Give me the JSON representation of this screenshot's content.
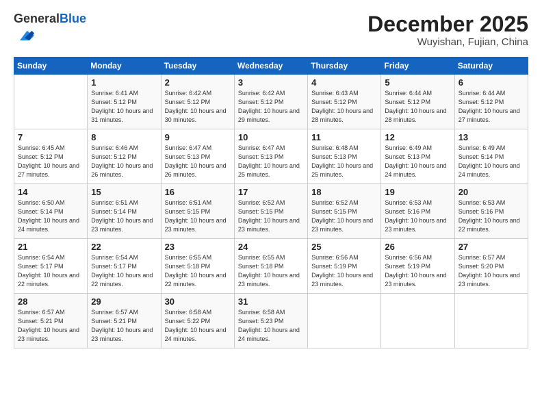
{
  "header": {
    "logo_general": "General",
    "logo_blue": "Blue",
    "month": "December 2025",
    "location": "Wuyishan, Fujian, China"
  },
  "weekdays": [
    "Sunday",
    "Monday",
    "Tuesday",
    "Wednesday",
    "Thursday",
    "Friday",
    "Saturday"
  ],
  "weeks": [
    [
      {
        "day": "",
        "sunrise": "",
        "sunset": "",
        "daylight": ""
      },
      {
        "day": "1",
        "sunrise": "Sunrise: 6:41 AM",
        "sunset": "Sunset: 5:12 PM",
        "daylight": "Daylight: 10 hours and 31 minutes."
      },
      {
        "day": "2",
        "sunrise": "Sunrise: 6:42 AM",
        "sunset": "Sunset: 5:12 PM",
        "daylight": "Daylight: 10 hours and 30 minutes."
      },
      {
        "day": "3",
        "sunrise": "Sunrise: 6:42 AM",
        "sunset": "Sunset: 5:12 PM",
        "daylight": "Daylight: 10 hours and 29 minutes."
      },
      {
        "day": "4",
        "sunrise": "Sunrise: 6:43 AM",
        "sunset": "Sunset: 5:12 PM",
        "daylight": "Daylight: 10 hours and 28 minutes."
      },
      {
        "day": "5",
        "sunrise": "Sunrise: 6:44 AM",
        "sunset": "Sunset: 5:12 PM",
        "daylight": "Daylight: 10 hours and 28 minutes."
      },
      {
        "day": "6",
        "sunrise": "Sunrise: 6:44 AM",
        "sunset": "Sunset: 5:12 PM",
        "daylight": "Daylight: 10 hours and 27 minutes."
      }
    ],
    [
      {
        "day": "7",
        "sunrise": "Sunrise: 6:45 AM",
        "sunset": "Sunset: 5:12 PM",
        "daylight": "Daylight: 10 hours and 27 minutes."
      },
      {
        "day": "8",
        "sunrise": "Sunrise: 6:46 AM",
        "sunset": "Sunset: 5:12 PM",
        "daylight": "Daylight: 10 hours and 26 minutes."
      },
      {
        "day": "9",
        "sunrise": "Sunrise: 6:47 AM",
        "sunset": "Sunset: 5:13 PM",
        "daylight": "Daylight: 10 hours and 26 minutes."
      },
      {
        "day": "10",
        "sunrise": "Sunrise: 6:47 AM",
        "sunset": "Sunset: 5:13 PM",
        "daylight": "Daylight: 10 hours and 25 minutes."
      },
      {
        "day": "11",
        "sunrise": "Sunrise: 6:48 AM",
        "sunset": "Sunset: 5:13 PM",
        "daylight": "Daylight: 10 hours and 25 minutes."
      },
      {
        "day": "12",
        "sunrise": "Sunrise: 6:49 AM",
        "sunset": "Sunset: 5:13 PM",
        "daylight": "Daylight: 10 hours and 24 minutes."
      },
      {
        "day": "13",
        "sunrise": "Sunrise: 6:49 AM",
        "sunset": "Sunset: 5:14 PM",
        "daylight": "Daylight: 10 hours and 24 minutes."
      }
    ],
    [
      {
        "day": "14",
        "sunrise": "Sunrise: 6:50 AM",
        "sunset": "Sunset: 5:14 PM",
        "daylight": "Daylight: 10 hours and 24 minutes."
      },
      {
        "day": "15",
        "sunrise": "Sunrise: 6:51 AM",
        "sunset": "Sunset: 5:14 PM",
        "daylight": "Daylight: 10 hours and 23 minutes."
      },
      {
        "day": "16",
        "sunrise": "Sunrise: 6:51 AM",
        "sunset": "Sunset: 5:15 PM",
        "daylight": "Daylight: 10 hours and 23 minutes."
      },
      {
        "day": "17",
        "sunrise": "Sunrise: 6:52 AM",
        "sunset": "Sunset: 5:15 PM",
        "daylight": "Daylight: 10 hours and 23 minutes."
      },
      {
        "day": "18",
        "sunrise": "Sunrise: 6:52 AM",
        "sunset": "Sunset: 5:15 PM",
        "daylight": "Daylight: 10 hours and 23 minutes."
      },
      {
        "day": "19",
        "sunrise": "Sunrise: 6:53 AM",
        "sunset": "Sunset: 5:16 PM",
        "daylight": "Daylight: 10 hours and 23 minutes."
      },
      {
        "day": "20",
        "sunrise": "Sunrise: 6:53 AM",
        "sunset": "Sunset: 5:16 PM",
        "daylight": "Daylight: 10 hours and 22 minutes."
      }
    ],
    [
      {
        "day": "21",
        "sunrise": "Sunrise: 6:54 AM",
        "sunset": "Sunset: 5:17 PM",
        "daylight": "Daylight: 10 hours and 22 minutes."
      },
      {
        "day": "22",
        "sunrise": "Sunrise: 6:54 AM",
        "sunset": "Sunset: 5:17 PM",
        "daylight": "Daylight: 10 hours and 22 minutes."
      },
      {
        "day": "23",
        "sunrise": "Sunrise: 6:55 AM",
        "sunset": "Sunset: 5:18 PM",
        "daylight": "Daylight: 10 hours and 22 minutes."
      },
      {
        "day": "24",
        "sunrise": "Sunrise: 6:55 AM",
        "sunset": "Sunset: 5:18 PM",
        "daylight": "Daylight: 10 hours and 23 minutes."
      },
      {
        "day": "25",
        "sunrise": "Sunrise: 6:56 AM",
        "sunset": "Sunset: 5:19 PM",
        "daylight": "Daylight: 10 hours and 23 minutes."
      },
      {
        "day": "26",
        "sunrise": "Sunrise: 6:56 AM",
        "sunset": "Sunset: 5:19 PM",
        "daylight": "Daylight: 10 hours and 23 minutes."
      },
      {
        "day": "27",
        "sunrise": "Sunrise: 6:57 AM",
        "sunset": "Sunset: 5:20 PM",
        "daylight": "Daylight: 10 hours and 23 minutes."
      }
    ],
    [
      {
        "day": "28",
        "sunrise": "Sunrise: 6:57 AM",
        "sunset": "Sunset: 5:21 PM",
        "daylight": "Daylight: 10 hours and 23 minutes."
      },
      {
        "day": "29",
        "sunrise": "Sunrise: 6:57 AM",
        "sunset": "Sunset: 5:21 PM",
        "daylight": "Daylight: 10 hours and 23 minutes."
      },
      {
        "day": "30",
        "sunrise": "Sunrise: 6:58 AM",
        "sunset": "Sunset: 5:22 PM",
        "daylight": "Daylight: 10 hours and 24 minutes."
      },
      {
        "day": "31",
        "sunrise": "Sunrise: 6:58 AM",
        "sunset": "Sunset: 5:23 PM",
        "daylight": "Daylight: 10 hours and 24 minutes."
      },
      {
        "day": "",
        "sunrise": "",
        "sunset": "",
        "daylight": ""
      },
      {
        "day": "",
        "sunrise": "",
        "sunset": "",
        "daylight": ""
      },
      {
        "day": "",
        "sunrise": "",
        "sunset": "",
        "daylight": ""
      }
    ]
  ]
}
